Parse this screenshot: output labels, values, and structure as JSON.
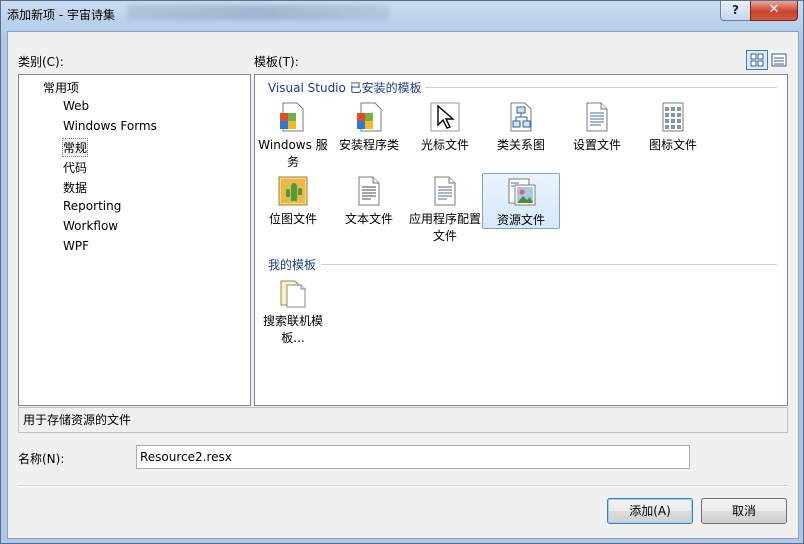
{
  "window": {
    "title": "添加新项 - 宇宙诗集",
    "help_label": "?",
    "close_label": "✕"
  },
  "categories": {
    "label": "类别(C):",
    "items": [
      {
        "label": "常用项",
        "level": 0
      },
      {
        "label": "Web",
        "level": 1
      },
      {
        "label": "Windows Forms",
        "level": 1
      },
      {
        "label": "常规",
        "level": 1,
        "selected": true
      },
      {
        "label": "代码",
        "level": 1
      },
      {
        "label": "数据",
        "level": 1
      },
      {
        "label": "Reporting",
        "level": 1
      },
      {
        "label": "Workflow",
        "level": 1
      },
      {
        "label": "WPF",
        "level": 1
      }
    ]
  },
  "templates": {
    "label": "模板(T):",
    "installed_header": "Visual Studio 已安装的模板",
    "my_header": "我的模板",
    "installed": [
      {
        "label": "Windows 服务",
        "icon": "windows-service-icon"
      },
      {
        "label": "安装程序类",
        "icon": "installer-class-icon"
      },
      {
        "label": "光标文件",
        "icon": "cursor-file-icon"
      },
      {
        "label": "类关系图",
        "icon": "class-diagram-icon"
      },
      {
        "label": "设置文件",
        "icon": "settings-file-icon"
      },
      {
        "label": "图标文件",
        "icon": "icon-file-icon"
      },
      {
        "label": "位图文件",
        "icon": "bitmap-file-icon"
      },
      {
        "label": "文本文件",
        "icon": "text-file-icon"
      },
      {
        "label": "应用程序配置文件",
        "icon": "app-config-file-icon"
      },
      {
        "label": "资源文件",
        "icon": "resource-file-icon",
        "selected": true
      }
    ],
    "mine": [
      {
        "label": "搜索联机模板...",
        "icon": "search-online-templates-icon"
      }
    ]
  },
  "description": "用于存储资源的文件",
  "name_field": {
    "label": "名称(N):",
    "value": "Resource2.resx"
  },
  "buttons": {
    "add": "添加(A)",
    "cancel": "取消"
  }
}
